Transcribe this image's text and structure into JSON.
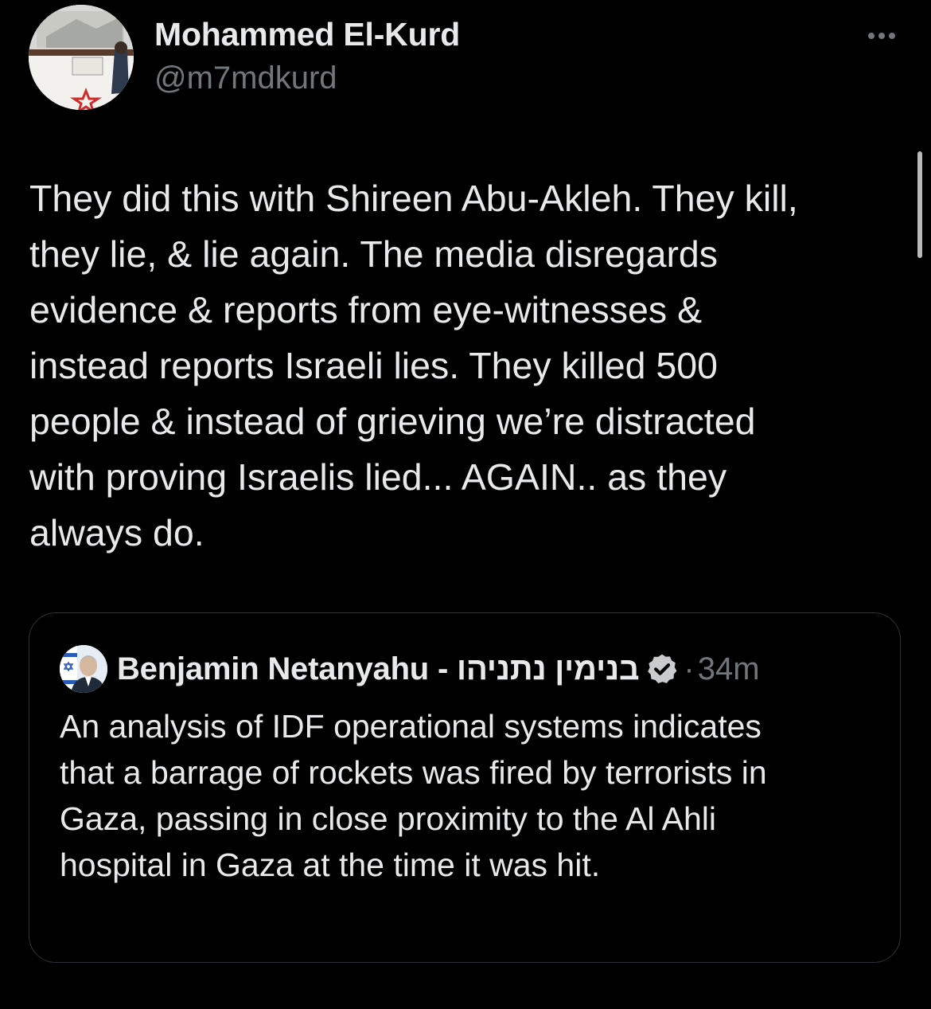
{
  "tweet": {
    "author_name": "Mohammed El-Kurd",
    "author_handle": "@m7mdkurd",
    "more_icon": "more-horizontal-icon",
    "text": "They did this with Shireen Abu-Akleh. They kill,\nthey lie, & lie again. The media disregards\nevidence & reports from eye-witnesses &\ninstead reports Israeli lies. They killed 500\npeople & instead of grieving we’re distracted\nwith proving Israelis lied... AGAIN.. as they\nalways do."
  },
  "quoted_tweet": {
    "author_name": "Benjamin Netanyahu - בנימין נתניהו",
    "verified_icon": "verified-badge-icon",
    "separator": "·",
    "time": "34m",
    "text": "An analysis of IDF operational systems indicates\nthat a barrage of rockets was fired by terrorists in\nGaza, passing in close proximity to the Al Ahli\nhospital in Gaza at the time it was hit."
  },
  "colors": {
    "background": "#000000",
    "primary_text": "#e7e9ea",
    "secondary_text": "#71767b",
    "card_border": "#2f3336"
  }
}
